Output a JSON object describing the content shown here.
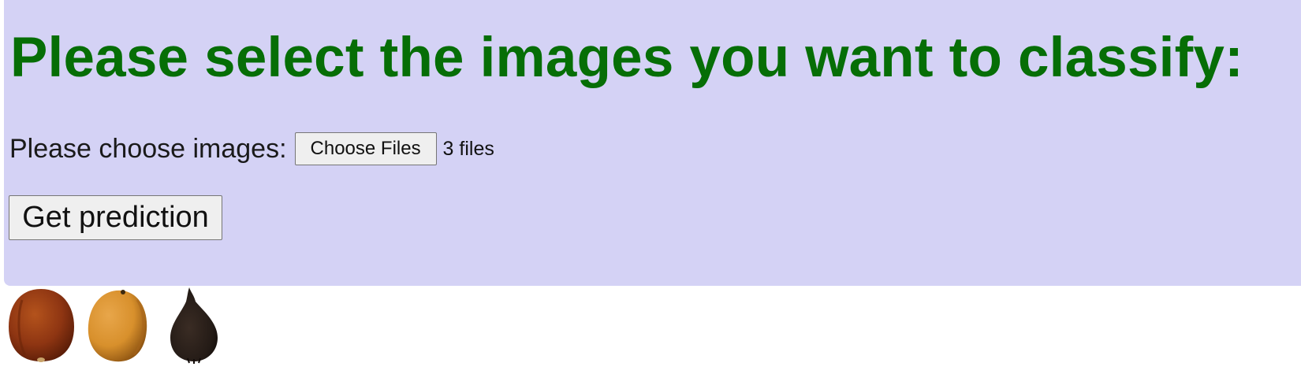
{
  "header": {
    "title": "Please select the images you want to classify:"
  },
  "file_picker": {
    "label": "Please choose images:",
    "button_label": "Choose Files",
    "status": "3 files"
  },
  "actions": {
    "predict_label": "Get prediction"
  },
  "previews": [
    {
      "name": "preview-image-1",
      "color": "#8e3512"
    },
    {
      "name": "preview-image-2",
      "color": "#d8902c"
    },
    {
      "name": "preview-image-3",
      "color": "#241b16"
    }
  ],
  "colors": {
    "panel_background": "#d4d2f5",
    "title_color": "#066e06"
  }
}
